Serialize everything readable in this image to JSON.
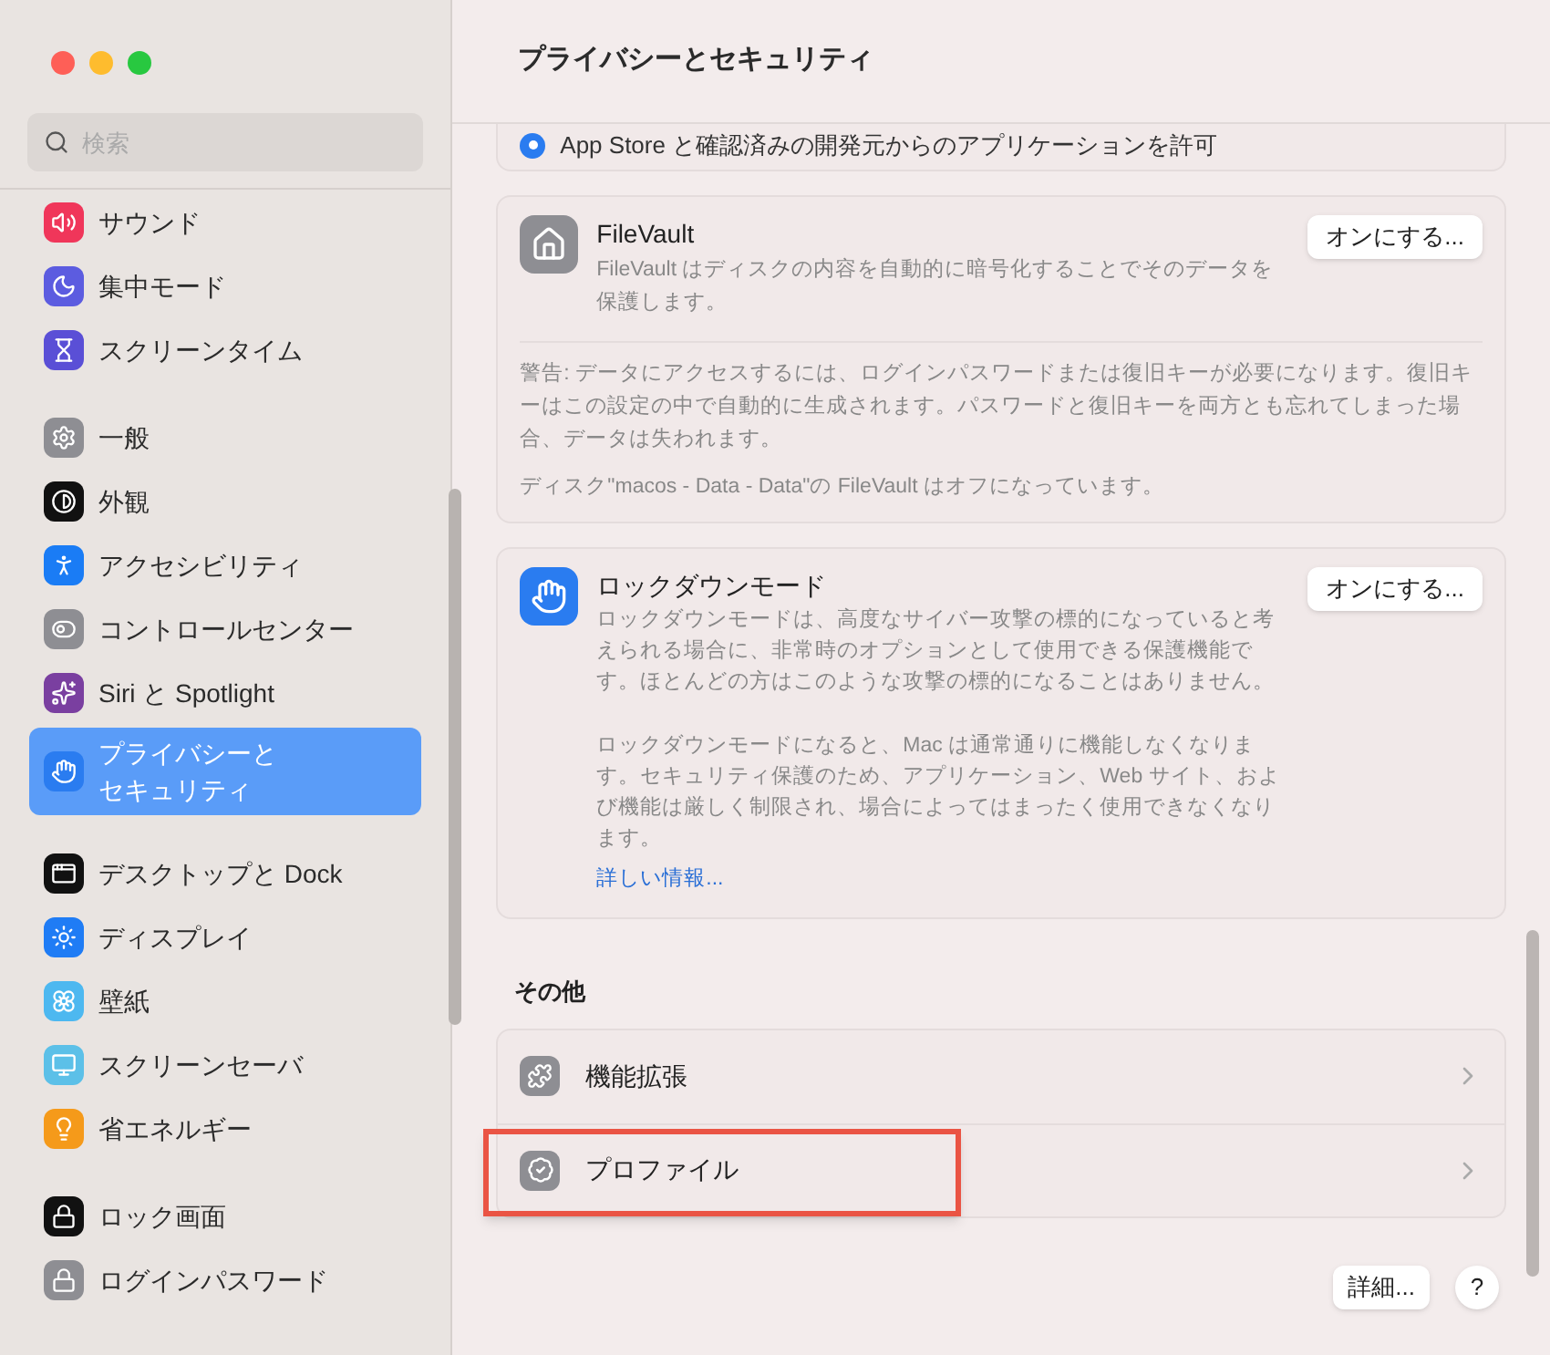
{
  "window": {
    "title": "プライバシーとセキュリティ"
  },
  "search": {
    "placeholder": "検索"
  },
  "sidebar": {
    "groups": [
      [
        {
          "label": "サウンド",
          "kind": "sound",
          "color": "#f0365a",
          "selected": false
        },
        {
          "label": "集中モード",
          "kind": "focus",
          "color": "#5c5ce0",
          "selected": false
        },
        {
          "label": "スクリーンタイム",
          "kind": "screentime",
          "color": "#5a4fd6",
          "selected": false
        }
      ],
      [
        {
          "label": "一般",
          "kind": "general",
          "color": "#8e8e93",
          "selected": false
        },
        {
          "label": "外観",
          "kind": "appearance",
          "color": "#111111",
          "selected": false
        },
        {
          "label": "アクセシビリティ",
          "kind": "accessibility",
          "color": "#1a7cf5",
          "selected": false
        },
        {
          "label": "コントロールセンター",
          "kind": "control",
          "color": "#8e8e93",
          "selected": false
        },
        {
          "label": "Siri と Spotlight",
          "kind": "siri",
          "color": "#7a3fa0",
          "selected": false
        },
        {
          "label": "プライバシーとセキュリティ",
          "kind": "privacy",
          "color": "#2a7cf0",
          "selected": true
        }
      ],
      [
        {
          "label": "デスクトップと Dock",
          "kind": "desktop",
          "color": "#111111",
          "selected": false
        },
        {
          "label": "ディスプレイ",
          "kind": "display",
          "color": "#1f7cf5",
          "selected": false
        },
        {
          "label": "壁紙",
          "kind": "wallpaper",
          "color": "#4db8f0",
          "selected": false
        },
        {
          "label": "スクリーンセーバ",
          "kind": "screensaver",
          "color": "#5cc0e8",
          "selected": false
        },
        {
          "label": "省エネルギー",
          "kind": "energy",
          "color": "#f59a1a",
          "selected": false
        }
      ],
      [
        {
          "label": "ロック画面",
          "kind": "lockscreen",
          "color": "#111111",
          "selected": false
        },
        {
          "label": "ログインパスワード",
          "kind": "password",
          "color": "#8e8e93",
          "selected": false
        }
      ]
    ]
  },
  "allow_option": {
    "label": "App Store と確認済みの開発元からのアプリケーションを許可",
    "selected": true
  },
  "filevault": {
    "title": "FileVault",
    "description": "FileVault はディスクの内容を自動的に暗号化することでそのデータを保護します。",
    "button": "オンにする...",
    "warning": "警告: データにアクセスするには、ログインパスワードまたは復旧キーが必要になります。復旧キーはこの設定の中で自動的に生成されます。パスワードと復旧キーを両方とも忘れてしまった場合、データは失われます。",
    "status": "ディスク\"macos - Data - Data\"の FileVault はオフになっています。"
  },
  "lockdown": {
    "title": "ロックダウンモード",
    "button": "オンにする...",
    "paragraphs": [
      "ロックダウンモードは、高度なサイバー攻撃の標的になっていると考えられる場合に、非常時のオプションとして使用できる保護機能です。ほとんどの方はこのような攻撃の標的になることはありません。",
      "ロックダウンモードになると、Mac は通常通りに機能しなくなります。セキュリティ保護のため、アプリケーション、Web サイト、および機能は厳しく制限され、場合によってはまったく使用できなくなります。"
    ],
    "link": "詳しい情報..."
  },
  "other_section": {
    "heading": "その他",
    "items": [
      {
        "label": "機能拡張",
        "kind": "extension",
        "highlighted": false
      },
      {
        "label": "プロファイル",
        "kind": "profile",
        "highlighted": true
      }
    ]
  },
  "footer_buttons": [
    "詳細...",
    "?"
  ]
}
